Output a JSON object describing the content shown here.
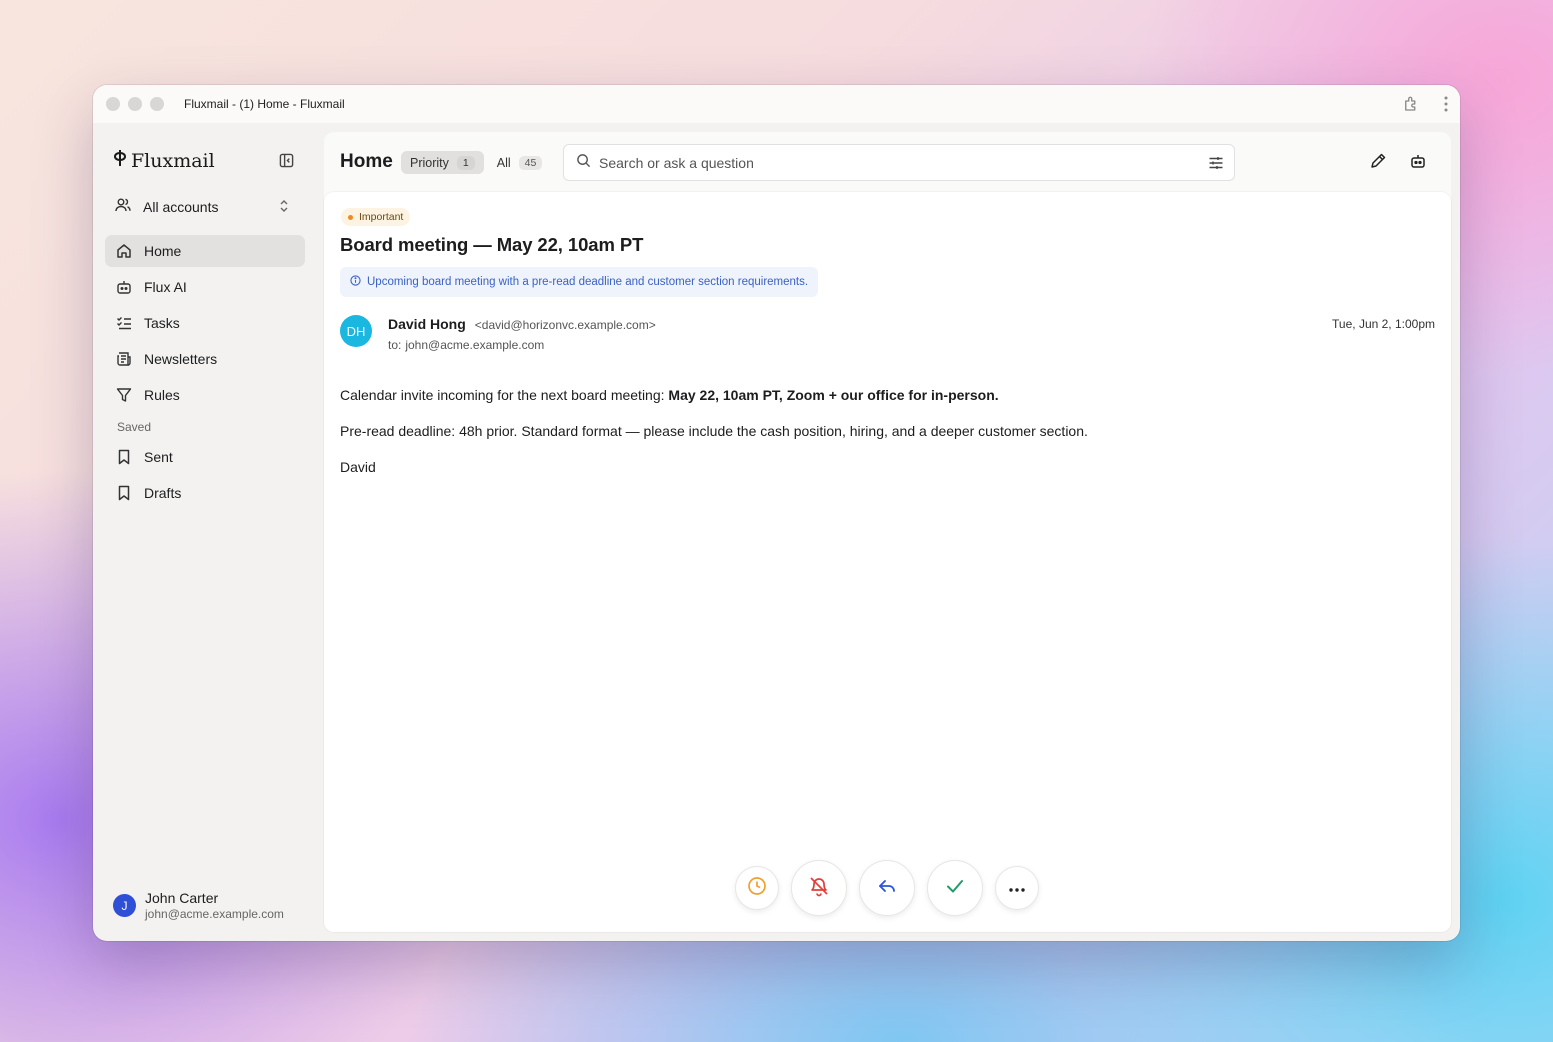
{
  "window": {
    "title": "Fluxmail - (1) Home - Fluxmail"
  },
  "sidebar": {
    "brand": "Fluxmail",
    "accounts_label": "All accounts",
    "items": [
      {
        "label": "Home",
        "icon": "home-icon",
        "active": true
      },
      {
        "label": "Flux AI",
        "icon": "robot-icon"
      },
      {
        "label": "Tasks",
        "icon": "tasks-icon"
      },
      {
        "label": "Newsletters",
        "icon": "newspaper-icon"
      },
      {
        "label": "Rules",
        "icon": "filter-icon"
      }
    ],
    "saved_label": "Saved",
    "saved_items": [
      {
        "label": "Sent",
        "icon": "bookmark-icon"
      },
      {
        "label": "Drafts",
        "icon": "bookmark-icon"
      }
    ],
    "user": {
      "initial": "J",
      "name": "John Carter",
      "email": "john@acme.example.com",
      "avatar_color": "#2e4fd6"
    }
  },
  "header": {
    "title": "Home",
    "tabs": [
      {
        "label": "Priority",
        "count": "1",
        "active": true
      },
      {
        "label": "All",
        "count": "45"
      }
    ],
    "search_placeholder": "Search or ask a question"
  },
  "email": {
    "badge": "Important",
    "subject": "Board meeting — May 22, 10am PT",
    "summary": "Upcoming board meeting with a pre-read deadline and customer section requirements.",
    "sender_initials": "DH",
    "sender_name": "David Hong",
    "sender_email": "<david@horizonvc.example.com>",
    "to_label": "to:",
    "to": "john@acme.example.com",
    "date": "Tue, Jun 2, 1:00pm",
    "body_line1_prefix": "Calendar invite incoming for the next board meeting: ",
    "body_line1_bold": "May 22, 10am PT, Zoom + our office for in-person.",
    "body_line2": "Pre-read deadline: 48h prior. Standard format — please include the cash position, hiring, and a deeper customer section.",
    "signature": "David"
  },
  "colors": {
    "accent": "#3b62c4",
    "important": "#f08a1c",
    "avatar": "#1ab7e0",
    "snooze": "#f0a030",
    "mute": "#e0403a",
    "done": "#1f9d6b"
  }
}
